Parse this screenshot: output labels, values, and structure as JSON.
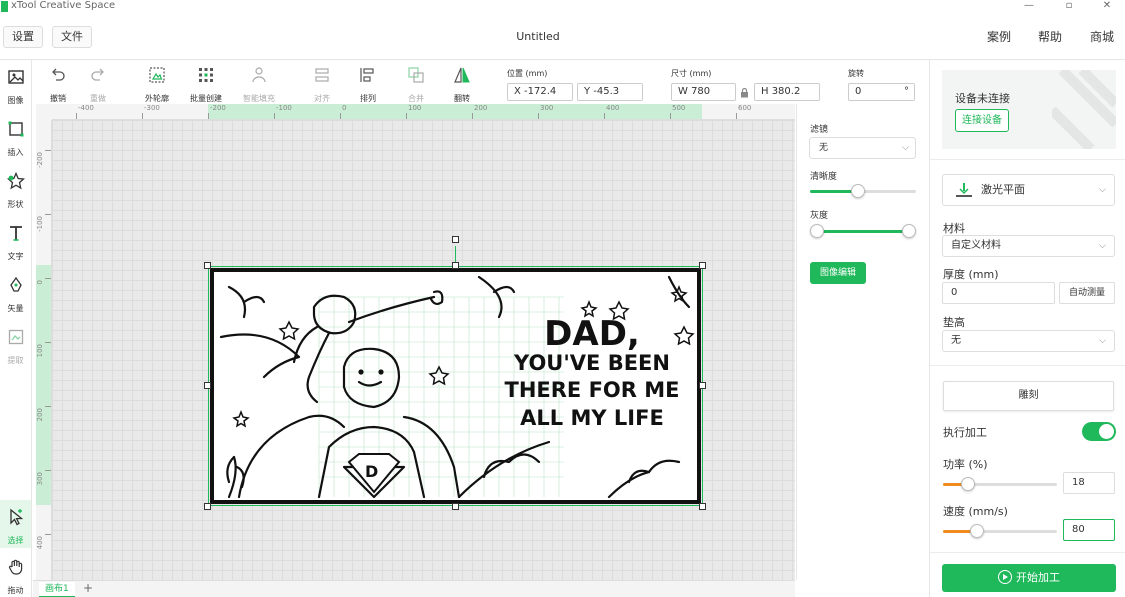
{
  "app": {
    "title": "xTool Creative Space"
  },
  "menu": {
    "settings": "设置",
    "file": "文件",
    "doc_title": "Untitled",
    "cases": "案例",
    "help": "帮助",
    "store": "商城"
  },
  "left_tools": [
    {
      "label": "图像",
      "icon": "image-icon"
    },
    {
      "label": "插入",
      "icon": "insert-icon"
    },
    {
      "label": "形状",
      "icon": "shape-icon"
    },
    {
      "label": "文字",
      "icon": "text-icon"
    },
    {
      "label": "矢量",
      "icon": "vector-pen-icon"
    },
    {
      "label": "提取",
      "icon": "extract-icon"
    },
    {
      "label": "选择",
      "icon": "select-cursor-icon"
    },
    {
      "label": "拖动",
      "icon": "hand-icon"
    }
  ],
  "edit_tools": {
    "undo": "撤销",
    "redo": "重做",
    "outline": "外轮廓",
    "batch": "批量创建",
    "smart_fill": "智能填充",
    "align": "对齐",
    "arrange": "排列",
    "combine": "合并",
    "flip": "翻转"
  },
  "position": {
    "label": "位置 (mm)",
    "x": "X -172.4",
    "y": "Y -45.3"
  },
  "size": {
    "label": "尺寸 (mm)",
    "w": "W 780",
    "h": "H 380.2"
  },
  "rotation": {
    "label": "旋转",
    "value": "0",
    "unit": "°"
  },
  "ruler": {
    "h_ticks": [
      "-400",
      "-300",
      "-200",
      "-100",
      "0",
      "100",
      "200",
      "300",
      "400",
      "500",
      "600",
      "700"
    ],
    "v_ticks": [
      "-200",
      "-100",
      "0",
      "100",
      "200",
      "300",
      "400"
    ]
  },
  "artwork": {
    "line1": "DAD,",
    "line2": "YOU'VE BEEN",
    "line3": "THERE FOR ME",
    "line4": "ALL MY LIFE",
    "badge": "D"
  },
  "image_panel": {
    "filter_label": "滤镜",
    "filter_value": "无",
    "sharpness_label": "清晰度",
    "sharpness": 0.45,
    "gray_label": "灰度",
    "gray_low": 0.0,
    "gray_high": 1.0,
    "edit_button": "图像编辑"
  },
  "device_panel": {
    "status": "设备未连接",
    "connect": "连接设备",
    "mode": "激光平面",
    "material_label": "材料",
    "material": "自定义材料",
    "thickness_label": "厚度 (mm)",
    "thickness": "0",
    "auto_measure": "自动测量",
    "raise_label": "垫高",
    "raise": "无",
    "process_type": "雕刻",
    "execute_label": "执行加工",
    "execute_on": true,
    "power_label": "功率 (%)",
    "power": "18",
    "power_frac": 0.18,
    "speed_label": "速度 (mm/s)",
    "speed": "80",
    "speed_frac": 0.27,
    "start": "开始加工"
  },
  "tabs": {
    "canvas": "画布1",
    "add": "+"
  },
  "colors": {
    "accent": "#1fb85a",
    "slider_orange": "#f08c1e"
  }
}
